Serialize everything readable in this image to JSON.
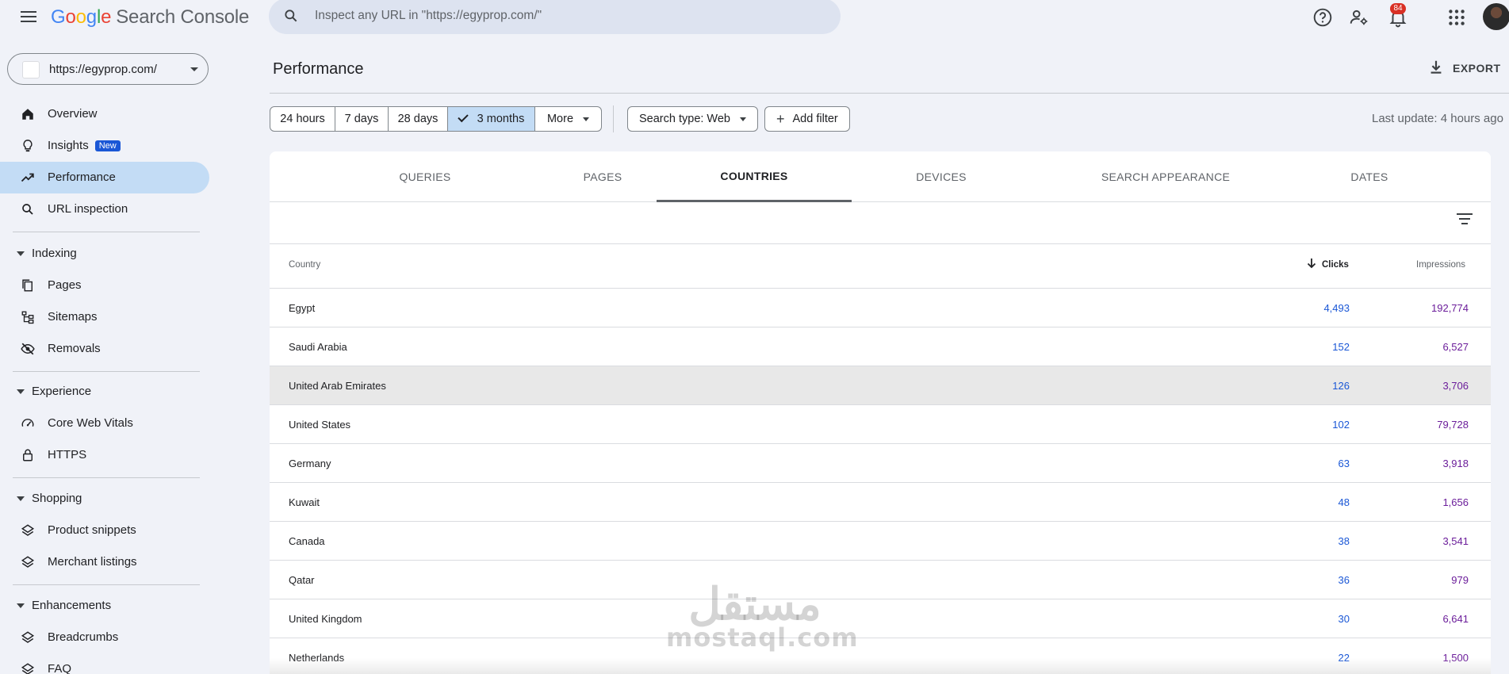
{
  "app": {
    "logo_google": [
      "G",
      "o",
      "o",
      "g",
      "l",
      "e"
    ],
    "logo_product": "Search Console"
  },
  "search": {
    "placeholder": "Inspect any URL in \"https://egyprop.com/\""
  },
  "notifications": {
    "count": "84"
  },
  "property": {
    "url": "https://egyprop.com/"
  },
  "sidebar": {
    "overview": "Overview",
    "insights": "Insights",
    "insights_badge": "New",
    "performance": "Performance",
    "url_inspection": "URL inspection",
    "indexing": "Indexing",
    "pages": "Pages",
    "sitemaps": "Sitemaps",
    "removals": "Removals",
    "experience": "Experience",
    "core_web_vitals": "Core Web Vitals",
    "https": "HTTPS",
    "shopping": "Shopping",
    "product_snippets": "Product snippets",
    "merchant_listings": "Merchant listings",
    "enhancements": "Enhancements",
    "breadcrumbs": "Breadcrumbs",
    "faq": "FAQ"
  },
  "header": {
    "title": "Performance",
    "export_label": "EXPORT"
  },
  "filters": {
    "ranges": [
      "24 hours",
      "7 days",
      "28 days",
      "3 months",
      "More"
    ],
    "selected_range": "3 months",
    "search_type": "Search type: Web",
    "add_filter": "Add filter",
    "last_update": "Last update: 4 hours ago"
  },
  "tabs": [
    "QUERIES",
    "PAGES",
    "COUNTRIES",
    "DEVICES",
    "SEARCH APPEARANCE",
    "DATES"
  ],
  "active_tab": "COUNTRIES",
  "table": {
    "columns": {
      "country": "Country",
      "clicks": "Clicks",
      "impressions": "Impressions"
    },
    "sort": "clicks-desc",
    "rows": [
      {
        "country": "Egypt",
        "clicks": "4,493",
        "impressions": "192,774"
      },
      {
        "country": "Saudi Arabia",
        "clicks": "152",
        "impressions": "6,527"
      },
      {
        "country": "United Arab Emirates",
        "clicks": "126",
        "impressions": "3,706"
      },
      {
        "country": "United States",
        "clicks": "102",
        "impressions": "79,728"
      },
      {
        "country": "Germany",
        "clicks": "63",
        "impressions": "3,918"
      },
      {
        "country": "Kuwait",
        "clicks": "48",
        "impressions": "1,656"
      },
      {
        "country": "Canada",
        "clicks": "38",
        "impressions": "3,541"
      },
      {
        "country": "Qatar",
        "clicks": "36",
        "impressions": "979"
      },
      {
        "country": "United Kingdom",
        "clicks": "30",
        "impressions": "6,641"
      },
      {
        "country": "Netherlands",
        "clicks": "22",
        "impressions": "1,500"
      }
    ],
    "highlighted_row": 2
  },
  "watermark": {
    "arabic": "مستقل",
    "latin": "mostaql.com"
  },
  "colors": {
    "accent": "#1a57d6",
    "impressions": "#6b1d9a",
    "active_nav": "#c3dcf5",
    "badge": "#d93025"
  }
}
